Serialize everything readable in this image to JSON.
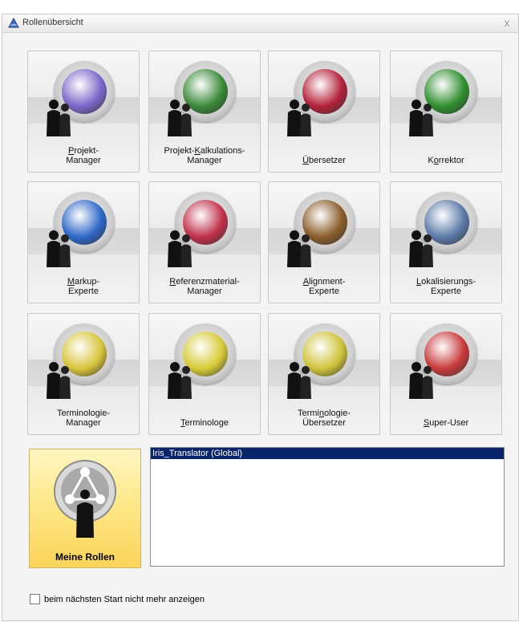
{
  "window": {
    "title": "Rollenübersicht",
    "close_glyph": "x"
  },
  "roles": [
    {
      "label_line1": "Projekt-",
      "label_line2": "Manager",
      "mnemonic": "P",
      "icon": "pyramid-globe-icon",
      "accent": "#7a66c9"
    },
    {
      "label_line1": "Projekt-Kalkulations-",
      "label_line2": "Manager",
      "mnemonic": "K",
      "icon": "abacus-icon",
      "accent": "#3a8a3a"
    },
    {
      "label_line1": "Übersetzer",
      "label_line2": "",
      "mnemonic": "Ü",
      "icon": "red-book-icon",
      "accent": "#b3213a"
    },
    {
      "label_line1": "Korrektor",
      "label_line2": "",
      "mnemonic": "o",
      "icon": "checkmark-magnifier-icon",
      "accent": "#2f8f2f"
    },
    {
      "label_line1": "Markup-",
      "label_line2": "Experte",
      "mnemonic": "M",
      "icon": "world-globe-icon",
      "accent": "#2d67c8"
    },
    {
      "label_line1": "Referenzmaterial-",
      "label_line2": "Manager",
      "mnemonic": "R",
      "icon": "layered-stack-icon",
      "accent": "#c0304a"
    },
    {
      "label_line1": "Alignment-",
      "label_line2": "Experte",
      "mnemonic": "A",
      "icon": "open-book-icon",
      "accent": "#8a5d2a"
    },
    {
      "label_line1": "Lokalisierungs-",
      "label_line2": "Experte",
      "mnemonic": "L",
      "icon": "screen-board-icon",
      "accent": "#5a7aa8"
    },
    {
      "label_line1": "Terminologie-",
      "label_line2": "Manager",
      "mnemonic": "",
      "icon": "glass-box-icon",
      "accent": "#d8c43a"
    },
    {
      "label_line1": "Terminologe",
      "label_line2": "",
      "mnemonic": "T",
      "icon": "book-stack-icon",
      "accent": "#d6cb36"
    },
    {
      "label_line1": "Terminologie-",
      "label_line2": "Übersetzer",
      "mnemonic": "n",
      "icon": "papers-book-icon",
      "accent": "#cfc23a"
    },
    {
      "label_line1": "Super-User",
      "label_line2": "",
      "mnemonic": "S",
      "icon": "color-wheel-icon",
      "accent": "#c83a3a"
    }
  ],
  "my_roles": {
    "label": "Meine Rollen",
    "icon": "network-people-icon"
  },
  "role_list": {
    "items": [
      "Iris_Translator (Global)"
    ],
    "selected": 0
  },
  "dont_show": {
    "label": "beim nächsten Start nicht mehr anzeigen",
    "checked": false
  }
}
